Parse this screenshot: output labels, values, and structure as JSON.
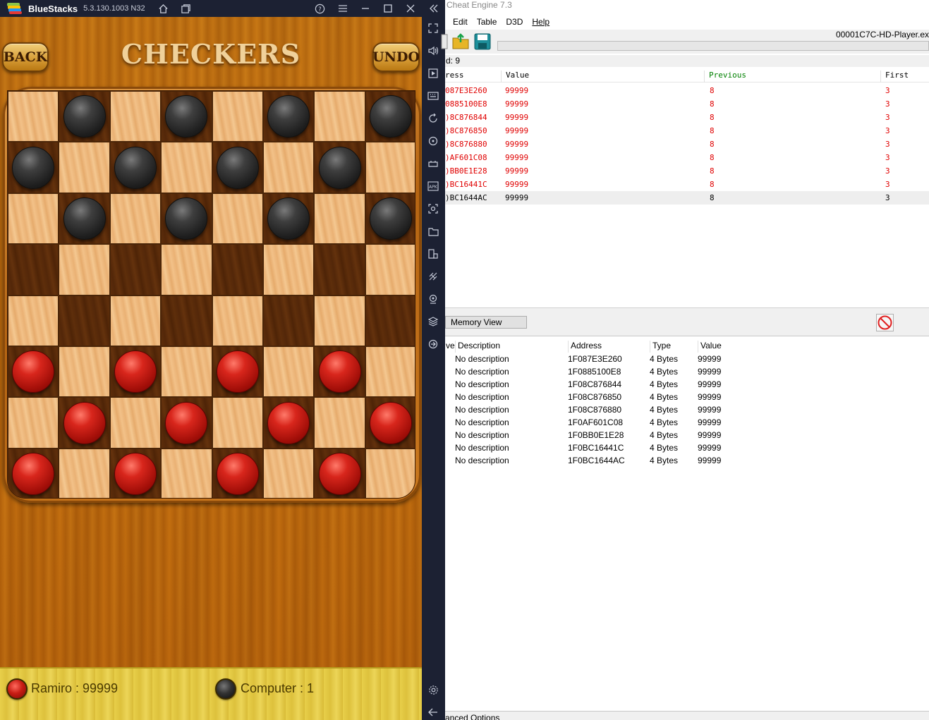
{
  "bluestacks": {
    "app_name": "BlueStacks",
    "version": "5.3.130.1003 N32",
    "logo_colors": [
      "#8bc34a",
      "#ffc107",
      "#2196f3",
      "#e53935"
    ]
  },
  "game": {
    "title": "CHECKERS",
    "back_label": "BACK",
    "undo_label": "UNDO",
    "board": [
      [
        "",
        "b",
        "",
        "b",
        "",
        "b",
        "",
        "b"
      ],
      [
        "b",
        "",
        "b",
        "",
        "b",
        "",
        "b",
        ""
      ],
      [
        "",
        "b",
        "",
        "b",
        "",
        "b",
        "",
        "b"
      ],
      [
        "",
        "",
        "",
        "",
        "",
        "",
        "",
        ""
      ],
      [
        "",
        "",
        "",
        "",
        "",
        "",
        "",
        ""
      ],
      [
        "r",
        "",
        "r",
        "",
        "r",
        "",
        "r",
        ""
      ],
      [
        "",
        "r",
        "",
        "r",
        "",
        "r",
        "",
        "r"
      ],
      [
        "r",
        "",
        "r",
        "",
        "r",
        "",
        "r",
        ""
      ]
    ],
    "player_score": "Ramiro : 99999",
    "computer_score": "Computer : 1"
  },
  "cheat_engine": {
    "title": "Cheat Engine 7.3",
    "menu": [
      "Edit",
      "Table",
      "D3D",
      "Help"
    ],
    "process": "00001C7C-HD-Player.ex",
    "found": "d: 9",
    "results_headers": [
      "ress",
      "Value",
      "Previous",
      "First"
    ],
    "results_header_colors": {
      "previous": "#008000"
    },
    "results": [
      {
        "address": "087E3E260",
        "value": "99999",
        "previous": "8",
        "first": "3",
        "state": "changed"
      },
      {
        "address": "0885100E8",
        "value": "99999",
        "previous": "8",
        "first": "3",
        "state": "changed"
      },
      {
        "address": ")8C876844",
        "value": "99999",
        "previous": "8",
        "first": "3",
        "state": "changed"
      },
      {
        "address": ")8C876850",
        "value": "99999",
        "previous": "8",
        "first": "3",
        "state": "changed"
      },
      {
        "address": ")8C876880",
        "value": "99999",
        "previous": "8",
        "first": "3",
        "state": "changed"
      },
      {
        "address": ")AF601C08",
        "value": "99999",
        "previous": "8",
        "first": "3",
        "state": "changed"
      },
      {
        "address": ")BB0E1E28",
        "value": "99999",
        "previous": "8",
        "first": "3",
        "state": "changed"
      },
      {
        "address": ")BC16441C",
        "value": "99999",
        "previous": "8",
        "first": "3",
        "state": "changed"
      },
      {
        "address": ")BC1644AC",
        "value": "99999",
        "previous": "8",
        "first": "3",
        "state": "selected"
      }
    ],
    "memory_view_label": "Memory View",
    "table_headers": [
      "ve",
      "Description",
      "Address",
      "Type",
      "Value"
    ],
    "table_rows": [
      {
        "description": "No description",
        "address": "1F087E3E260",
        "type": "4 Bytes",
        "value": "99999"
      },
      {
        "description": "No description",
        "address": "1F0885100E8",
        "type": "4 Bytes",
        "value": "99999"
      },
      {
        "description": "No description",
        "address": "1F08C876844",
        "type": "4 Bytes",
        "value": "99999"
      },
      {
        "description": "No description",
        "address": "1F08C876850",
        "type": "4 Bytes",
        "value": "99999"
      },
      {
        "description": "No description",
        "address": "1F08C876880",
        "type": "4 Bytes",
        "value": "99999"
      },
      {
        "description": "No description",
        "address": "1F0AF601C08",
        "type": "4 Bytes",
        "value": "99999"
      },
      {
        "description": "No description",
        "address": "1F0BB0E1E28",
        "type": "4 Bytes",
        "value": "99999"
      },
      {
        "description": "No description",
        "address": "1F0BC16441C",
        "type": "4 Bytes",
        "value": "99999"
      },
      {
        "description": "No description",
        "address": "1F0BC1644AC",
        "type": "4 Bytes",
        "value": "99999"
      }
    ],
    "advanced_options_label": "anced Options"
  },
  "icons": {
    "titlebar": [
      "home-icon",
      "multi-instance-icon",
      "help-icon",
      "menu-icon",
      "minimize-icon",
      "maximize-icon",
      "close-icon",
      "collapse-sidebar-icon"
    ],
    "sidebar": [
      "fullscreen-icon",
      "volume-icon",
      "screen-record-icon",
      "keyboard-icon",
      "rotate-icon",
      "sync-icon",
      "gamepad-icon",
      "apk-install-icon",
      "screenshot-icon",
      "folder-icon",
      "multi-instance-icon",
      "eco-mode-icon",
      "location-icon",
      "layers-icon",
      "macro-icon",
      "settings-icon",
      "back-icon"
    ]
  }
}
